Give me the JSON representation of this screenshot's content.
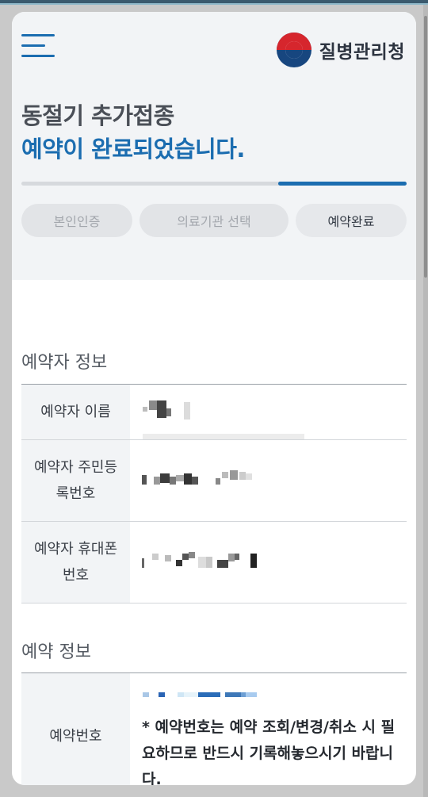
{
  "header": {
    "logo_text": "질병관리청",
    "title_line1": "동절기 추가접종",
    "title_line2": "예약이 완료되었습니다.",
    "progress_fraction": 0.333,
    "steps": [
      {
        "label": "본인인증"
      },
      {
        "label": "의료기관 선택"
      },
      {
        "label": "예약완료"
      }
    ]
  },
  "reserver_section": {
    "title": "예약자 정보",
    "rows": [
      {
        "label": "예약자 이름"
      },
      {
        "label": "예약자 주민등록번호"
      },
      {
        "label": "예약자 휴대폰번호"
      }
    ]
  },
  "reservation_section": {
    "title": "예약 정보",
    "rows": [
      {
        "label": "예약번호",
        "notice": "* 예약번호는 예약 조회/변경/취소 시 필요하므로 반드시 기록해놓으시기 바랍니다."
      }
    ]
  },
  "colors": {
    "accent": "#1b6db0",
    "title_gray": "#4a4f57",
    "header_bg": "#f2f4f6"
  }
}
